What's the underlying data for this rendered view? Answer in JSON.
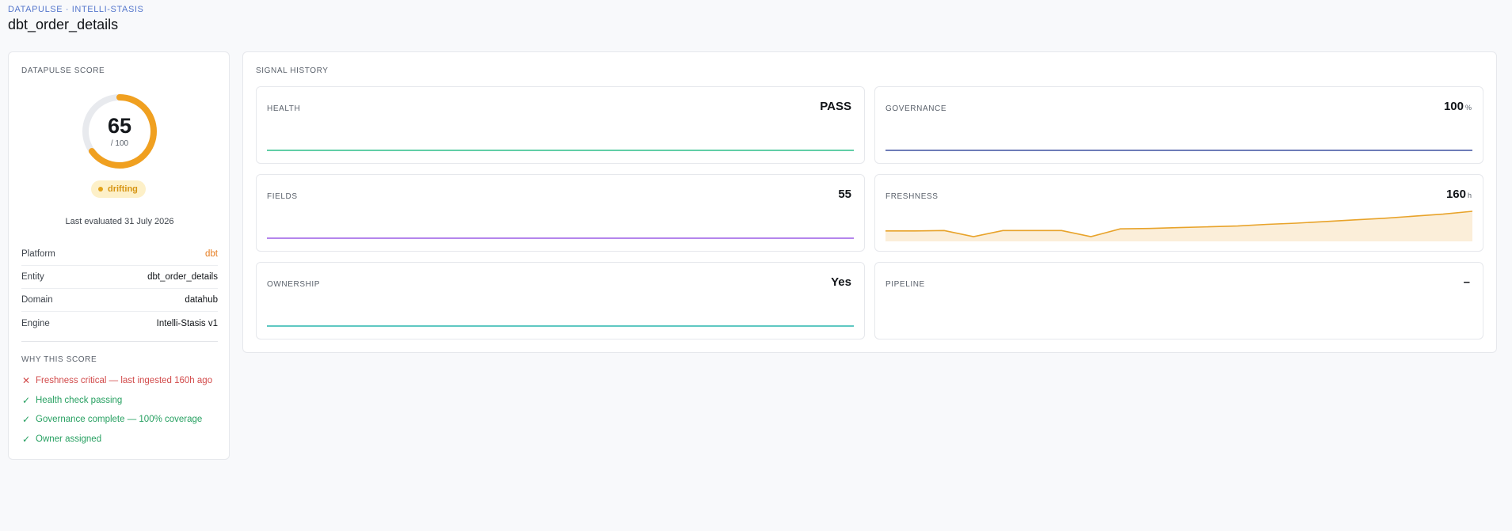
{
  "header": {
    "breadcrumb": "DATAPULSE · INTELLI-STASIS",
    "title": "dbt_order_details"
  },
  "score_card": {
    "label": "DATAPULSE SCORE",
    "score": 65,
    "score_text": "65",
    "max_text": "/ 100",
    "status": "drifting",
    "last_evaluated": "Last evaluated 31 July 2026",
    "meta": [
      {
        "key": "Platform",
        "value": "dbt"
      },
      {
        "key": "Entity",
        "value": "dbt_order_details"
      },
      {
        "key": "Domain",
        "value": "datahub"
      },
      {
        "key": "Engine",
        "value": "Intelli-Stasis v1"
      }
    ],
    "why_label": "WHY THIS SCORE",
    "reasons": [
      {
        "icon": "cross-icon",
        "text": "Freshness critical — last ingested 160h ago",
        "status": "bad"
      },
      {
        "icon": "check-icon",
        "text": "Health check passing",
        "status": "good"
      },
      {
        "icon": "check-icon",
        "text": "Governance complete — 100% coverage",
        "status": "good"
      },
      {
        "icon": "check-icon",
        "text": "Owner assigned",
        "status": "good"
      }
    ]
  },
  "signal_history": {
    "label": "SIGNAL HISTORY",
    "tiles": [
      {
        "label": "HEALTH",
        "value": "PASS",
        "unit": ""
      },
      {
        "label": "GOVERNANCE",
        "value": "100",
        "unit": "%"
      },
      {
        "label": "FIELDS",
        "value": "55",
        "unit": ""
      },
      {
        "label": "FRESHNESS",
        "value": "160",
        "unit": "h"
      },
      {
        "label": "OWNERSHIP",
        "value": "Yes",
        "unit": ""
      },
      {
        "label": "PIPELINE",
        "value": "–",
        "unit": ""
      }
    ]
  },
  "colors": {
    "accent": "#f0a020",
    "health": "#2dbd8a",
    "governance": "#3f51a0",
    "fields": "#9b5de5",
    "freshness": "#e8a32a",
    "ownership": "#2ab5ad",
    "bad": "#d24b4b",
    "good": "#27a061"
  },
  "chart_data": {
    "type": "line",
    "title": "",
    "series": [
      {
        "values": [
          1,
          1,
          1,
          1,
          1,
          1,
          1,
          1,
          1,
          1,
          1,
          1,
          1,
          1,
          1,
          1,
          1,
          1,
          1,
          1,
          1
        ]
      },
      {
        "values": [
          100,
          100,
          100,
          100,
          100,
          100,
          100,
          100,
          100,
          100,
          100,
          100,
          100,
          100,
          100,
          100,
          100,
          100,
          100,
          100,
          100
        ]
      },
      {
        "values": [
          55,
          55,
          55,
          55,
          55,
          55,
          55,
          55,
          55,
          55,
          55,
          55,
          55,
          55,
          55,
          55,
          55,
          55,
          55,
          55,
          55
        ]
      },
      {
        "values": [
          112,
          112,
          113,
          98,
          113,
          113,
          113,
          98,
          117,
          118,
          120,
          122,
          124,
          128,
          131,
          135,
          139,
          143,
          148,
          153,
          160
        ]
      },
      {
        "values": [
          1,
          1,
          1,
          1,
          1,
          1,
          1,
          1,
          1,
          1,
          1,
          1,
          1,
          1,
          1,
          1,
          1,
          1,
          1,
          1,
          1
        ]
      },
      {
        "values": []
      }
    ]
  }
}
